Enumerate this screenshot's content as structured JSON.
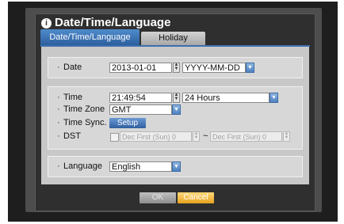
{
  "window": {
    "title": "Date/Time/Language"
  },
  "tabs": [
    {
      "label": "Date/Time/Language",
      "active": true
    },
    {
      "label": "Holiday",
      "active": false
    }
  ],
  "date": {
    "label": "Date",
    "value": "2013-01-01",
    "format": "YYYY-MM-DD"
  },
  "time": {
    "label": "Time",
    "value": "21:49:54",
    "format": "24 Hours"
  },
  "timezone": {
    "label": "Time Zone",
    "value": "GMT"
  },
  "timesync": {
    "label": "Time Sync.",
    "button": "Setup"
  },
  "dst": {
    "label": "DST",
    "checked": false,
    "start": "Dec First (Sun) 0",
    "end": "Dec First (Sun) 0",
    "separator": "~"
  },
  "language": {
    "label": "Language",
    "value": "English"
  },
  "footer": {
    "ok": "OK",
    "cancel": "Cancel"
  },
  "colors": {
    "tab_active": "#3d6fae",
    "cancel_button": "#f0b03a",
    "panel": "#c8c8c8"
  },
  "icons": {
    "title": "info-icon",
    "dropdown": "chevron-down-icon",
    "spinner": "spinner-arrows-icon"
  }
}
